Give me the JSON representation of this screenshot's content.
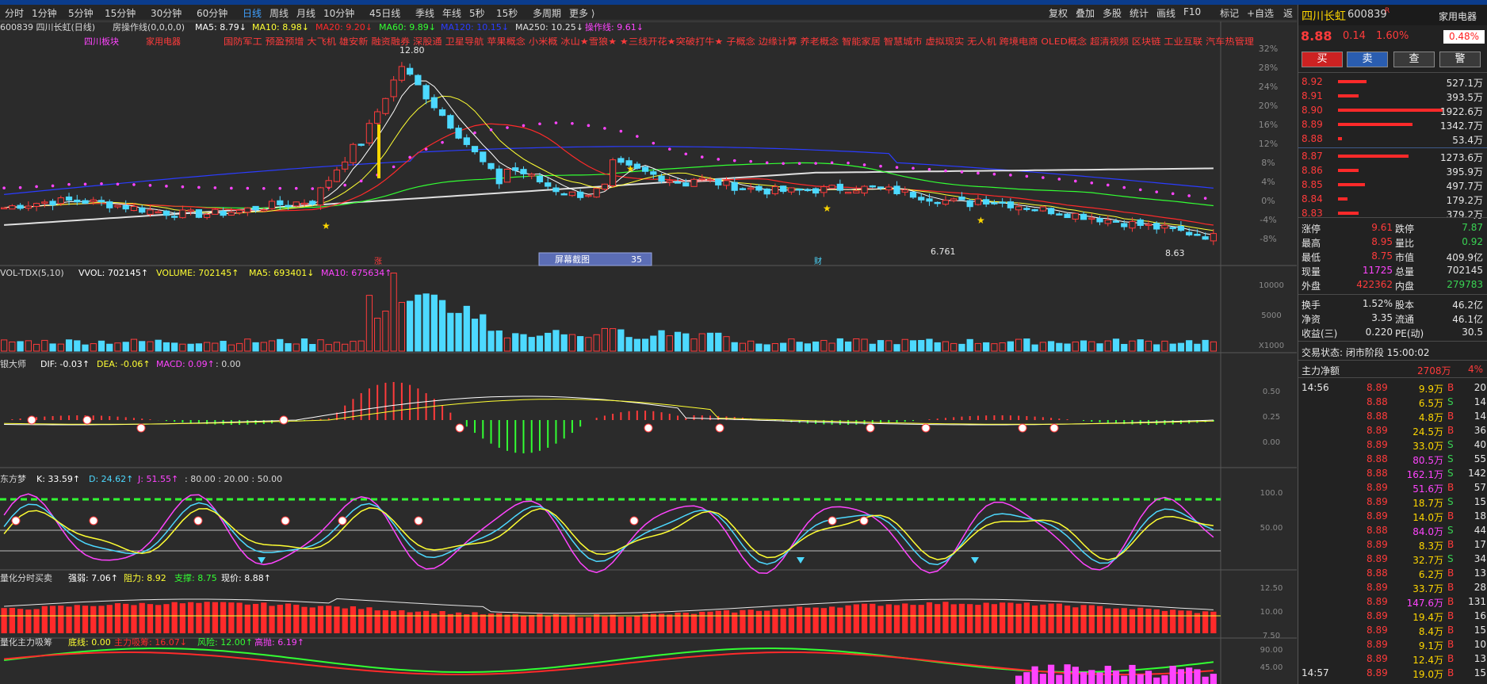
{
  "toolbar": {
    "periods": [
      "分时",
      "1分钟",
      "5分钟",
      "15分钟",
      "30分钟",
      "60分钟",
      "日线",
      "周线",
      "月线",
      "10分钟",
      "45日线",
      "季线",
      "年线",
      "5秒",
      "15秒",
      "多周期",
      "更多 ⟩"
    ],
    "active_period": "日线",
    "right_buttons": [
      "复权",
      "叠加",
      "多股",
      "统计",
      "画线",
      "F10",
      "标记",
      "+自选",
      "返回"
    ]
  },
  "main_chart": {
    "header_code": "600839 四川长虹(日线)",
    "indicator_name": "房操作线(0,0,0,0)",
    "ma5": "MA5: 8.79↓",
    "ma10": "MA10: 8.98↓",
    "ma20": "MA20: 9.20↓",
    "ma60": "MA60: 9.89↓",
    "ma120": "MA120: 10.15↓",
    "ma250": "MA250: 10.25↓",
    "op_line": "操作线: 9.61↓",
    "concepts_left": [
      "四川板块",
      "家用电器"
    ],
    "concepts_text": "国防军工 预盈预增 大飞机 雄安新 融资融券 深股通 卫星导航 苹果概念 小米概 冰山★雪狼★  ★三线开花★突破打牛★ 子概念 边缘计算 养老概念 智能家居 智慧城市 虚拟现实 无人机 跨境电商 OLED概念 超清视频 区块链 工业互联 汽车热管理",
    "high_label": "12.80",
    "low_label": "8.63",
    "mid_label": "6.761",
    "markers": {
      "zhang": "涨",
      "cai": "财"
    },
    "screenshot_label": "屏幕截图",
    "screenshot_count": "35",
    "y_ticks": [
      "32%",
      "28%",
      "24%",
      "20%",
      "16%",
      "12%",
      "8%",
      "4%",
      "0%",
      "-4%",
      "-8%"
    ]
  },
  "vol_panel": {
    "name": "VOL-TDX(5,10)",
    "vvol": "VVOL: 702145↑",
    "volume": "VOLUME: 702145↑",
    "ma5": "MA5: 693401↓",
    "ma10": "MA10: 675634↑",
    "y_ticks": [
      "10000",
      "5000",
      "X1000"
    ]
  },
  "macd_panel": {
    "name": "银大师",
    "dif": "DIF: -0.03↑",
    "dea": "DEA: -0.06↑",
    "macd": "MACD: 0.09↑",
    "extra": ": 0.00",
    "y_ticks": [
      "0.50",
      "0.25",
      "0.00"
    ]
  },
  "kdj_panel": {
    "name": "东方梦",
    "k": "K: 33.59↑",
    "d": "D: 24.62↑",
    "j": "J: 51.55↑",
    "levels": ": 80.00 : 20.00 : 50.00",
    "y_ticks": [
      "100.0",
      "50.00"
    ]
  },
  "strength_panel": {
    "name": "量化分时买卖",
    "strong": "强弱: 7.06↑",
    "resist": "阻力: 8.92",
    "support": "支撑: 8.75",
    "price": "现价: 8.88↑",
    "y_ticks": [
      "12.50",
      "10.00",
      "7.50"
    ]
  },
  "money_panel": {
    "name": "量化主力吸筹",
    "base": "底线: 0.00",
    "main": "主力吸筹: 16.07↓",
    "risk": "风险: 12.00↑",
    "score": "高抛: 6.19↑",
    "y_ticks": [
      "90.00",
      "45.00"
    ]
  },
  "quote": {
    "name": "四川长虹",
    "code": "600839",
    "flag": "R",
    "sector": "家用电器",
    "pct_badge": "0.48%",
    "price": "8.88",
    "change": "0.14",
    "change_pct": "1.60%",
    "buttons": [
      "买",
      "卖",
      "查",
      "警"
    ],
    "asks": [
      {
        "price": "8.92",
        "vol": "527.1万",
        "bar": 0.15
      },
      {
        "price": "8.91",
        "vol": "393.5万",
        "bar": 0.11
      },
      {
        "price": "8.90",
        "vol": "1922.6万",
        "bar": 0.55
      },
      {
        "price": "8.89",
        "vol": "1342.7万",
        "bar": 0.39
      },
      {
        "price": "8.88",
        "vol": "53.4万",
        "bar": 0.02
      }
    ],
    "bids": [
      {
        "price": "8.87",
        "vol": "1273.6万",
        "bar": 0.37
      },
      {
        "price": "8.86",
        "vol": "395.9万",
        "bar": 0.11
      },
      {
        "price": "8.85",
        "vol": "497.7万",
        "bar": 0.14
      },
      {
        "price": "8.84",
        "vol": "179.2万",
        "bar": 0.05
      },
      {
        "price": "8.83",
        "vol": "379.2万",
        "bar": 0.11
      }
    ],
    "stats": [
      {
        "l1": "涨停",
        "v1": "9.61",
        "c1": "red",
        "l2": "跌停",
        "v2": "7.87",
        "c2": "green"
      },
      {
        "l1": "最高",
        "v1": "8.95",
        "c1": "red",
        "l2": "量比",
        "v2": "0.92",
        "c2": "green"
      },
      {
        "l1": "最低",
        "v1": "8.75",
        "c1": "red",
        "l2": "市值",
        "v2": "409.9亿",
        "c2": "white"
      },
      {
        "l1": "现量",
        "v1": "11725",
        "c1": "magenta",
        "l2": "总量",
        "v2": "702145",
        "c2": "white"
      },
      {
        "l1": "外盘",
        "v1": "422362",
        "c1": "red",
        "l2": "内盘",
        "v2": "279783",
        "c2": "green"
      }
    ],
    "stats2": [
      {
        "l1": "换手",
        "v1": "1.52%",
        "l2": "股本",
        "v2": "46.2亿"
      },
      {
        "l1": "净资",
        "v1": "3.35",
        "l2": "流通",
        "v2": "46.1亿"
      },
      {
        "l1": "收益(三)",
        "v1": "0.220",
        "l2": "PE(动)",
        "v2": "30.5"
      }
    ],
    "trade_status": "交易状态: 闭市阶段 15:00:02",
    "main_net_label": "主力净额",
    "main_net_value": "2708万",
    "main_net_pct": "4%",
    "ticks": [
      {
        "time": "14:56",
        "price": "8.89",
        "vol": "9.9万",
        "side": "B",
        "n": "20"
      },
      {
        "time": "",
        "price": "8.88",
        "vol": "6.5万",
        "side": "S",
        "n": "14"
      },
      {
        "time": "",
        "price": "8.88",
        "vol": "4.8万",
        "side": "B",
        "n": "14"
      },
      {
        "time": "",
        "price": "8.89",
        "vol": "24.5万",
        "side": "B",
        "n": "36"
      },
      {
        "time": "",
        "price": "8.89",
        "vol": "33.0万",
        "side": "S",
        "n": "40"
      },
      {
        "time": "",
        "price": "8.88",
        "vol": "80.5万",
        "side": "S",
        "n": "55"
      },
      {
        "time": "",
        "price": "8.88",
        "vol": "162.1万",
        "side": "S",
        "n": "142"
      },
      {
        "time": "",
        "price": "8.89",
        "vol": "51.6万",
        "side": "B",
        "n": "57"
      },
      {
        "time": "",
        "price": "8.89",
        "vol": "18.7万",
        "side": "S",
        "n": "15"
      },
      {
        "time": "",
        "price": "8.89",
        "vol": "14.0万",
        "side": "B",
        "n": "18"
      },
      {
        "time": "",
        "price": "8.88",
        "vol": "84.0万",
        "side": "S",
        "n": "44"
      },
      {
        "time": "",
        "price": "8.89",
        "vol": "8.3万",
        "side": "B",
        "n": "17"
      },
      {
        "time": "",
        "price": "8.89",
        "vol": "32.7万",
        "side": "S",
        "n": "34"
      },
      {
        "time": "",
        "price": "8.88",
        "vol": "6.2万",
        "side": "B",
        "n": "13"
      },
      {
        "time": "",
        "price": "8.89",
        "vol": "33.7万",
        "side": "B",
        "n": "28"
      },
      {
        "time": "",
        "price": "8.89",
        "vol": "147.6万",
        "side": "B",
        "n": "131"
      },
      {
        "time": "",
        "price": "8.89",
        "vol": "19.4万",
        "side": "B",
        "n": "16"
      },
      {
        "time": "",
        "price": "8.89",
        "vol": "8.4万",
        "side": "B",
        "n": "15"
      },
      {
        "time": "",
        "price": "8.89",
        "vol": "9.1万",
        "side": "B",
        "n": "10"
      },
      {
        "time": "",
        "price": "8.89",
        "vol": "12.4万",
        "side": "B",
        "n": "13"
      },
      {
        "time": "14:57",
        "price": "8.89",
        "vol": "19.0万",
        "side": "B",
        "n": "15"
      }
    ]
  },
  "colors": {
    "up": "#ff3b3b",
    "down": "#4dd9ff",
    "ma5": "#ffffff",
    "ma10": "#ffff33",
    "ma20": "#ff2a2a",
    "ma60": "#33ff33",
    "ma120": "#2b3cff",
    "ma250": "#e0e0e0",
    "op": "#ff44ff"
  }
}
